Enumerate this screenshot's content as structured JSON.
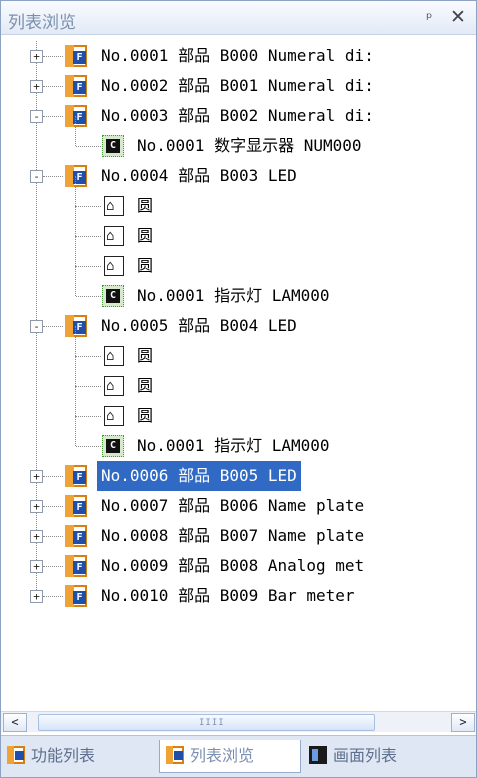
{
  "panel": {
    "title": "列表浏览",
    "pin_icon": "pin-icon",
    "close_icon": "close-icon"
  },
  "tree": {
    "rows": [
      {
        "kind": "part",
        "expander": "+",
        "text": "No.0001 部品 B000     Numeral di:"
      },
      {
        "kind": "part",
        "expander": "+",
        "text": "No.0002 部品 B001     Numeral di:"
      },
      {
        "kind": "part",
        "expander": "-",
        "text": "No.0003 部品 B002     Numeral di:"
      },
      {
        "kind": "child",
        "text": "No.0001 数字显示器 NUM000"
      },
      {
        "kind": "part",
        "expander": "-",
        "text": "No.0004 部品 B003     LED"
      },
      {
        "kind": "shape",
        "text": "圆"
      },
      {
        "kind": "shape",
        "text": "圆"
      },
      {
        "kind": "shape",
        "text": "圆"
      },
      {
        "kind": "child",
        "text": "No.0001 指示灯 LAM000"
      },
      {
        "kind": "part",
        "expander": "-",
        "text": "No.0005 部品 B004     LED"
      },
      {
        "kind": "shape",
        "text": "圆"
      },
      {
        "kind": "shape",
        "text": "圆"
      },
      {
        "kind": "shape",
        "text": "圆"
      },
      {
        "kind": "child",
        "text": "No.0001 指示灯 LAM000"
      },
      {
        "kind": "part",
        "expander": "+",
        "text": "No.0006 部品 B005     LED",
        "selected": true
      },
      {
        "kind": "part",
        "expander": "+",
        "text": "No.0007 部品 B006     Name plate"
      },
      {
        "kind": "part",
        "expander": "+",
        "text": "No.0008 部品 B007     Name plate"
      },
      {
        "kind": "part",
        "expander": "+",
        "text": "No.0009 部品 B008     Analog met"
      },
      {
        "kind": "part",
        "expander": "+",
        "text": "No.0010 部品 B009     Bar meter"
      }
    ],
    "icon_labels": {
      "part": "F",
      "child": "C",
      "shape": "⌂"
    }
  },
  "scrollbar": {
    "left_arrow": "<",
    "right_arrow": ">",
    "grip": "IIII"
  },
  "tabs": [
    {
      "label": "功能列表",
      "icon": "function-list-icon"
    },
    {
      "label": "列表浏览",
      "icon": "list-browse-icon",
      "active": true
    },
    {
      "label": "画面列表",
      "icon": "screen-list-icon"
    }
  ]
}
